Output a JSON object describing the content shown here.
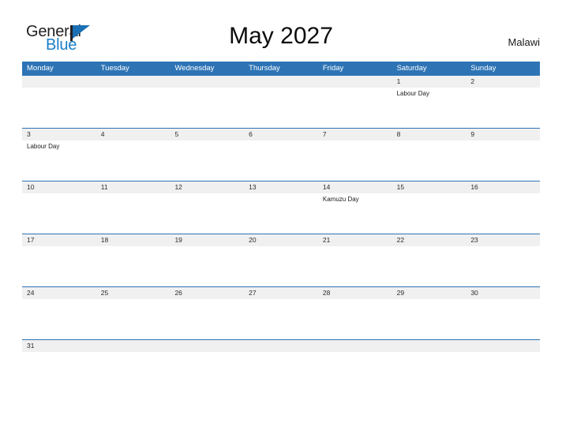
{
  "logo": {
    "text_dark": "General",
    "text_blue": "Blue",
    "accent_color": "#1a7ec8",
    "triangle_color": "#1a6fb5"
  },
  "header": {
    "title": "May 2027",
    "country": "Malawi"
  },
  "theme": {
    "header_blue": "#2e74b5",
    "row_band_gray": "#f0f0f0",
    "text_dark": "#1a1a1a"
  },
  "calendar": {
    "month": "May",
    "year": "2027",
    "weekday_headers": [
      "Monday",
      "Tuesday",
      "Wednesday",
      "Thursday",
      "Friday",
      "Saturday",
      "Sunday"
    ],
    "weeks": [
      {
        "days": [
          {
            "num": "",
            "event": ""
          },
          {
            "num": "",
            "event": ""
          },
          {
            "num": "",
            "event": ""
          },
          {
            "num": "",
            "event": ""
          },
          {
            "num": "",
            "event": ""
          },
          {
            "num": "1",
            "event": "Labour Day"
          },
          {
            "num": "2",
            "event": ""
          }
        ]
      },
      {
        "days": [
          {
            "num": "3",
            "event": "Labour Day"
          },
          {
            "num": "4",
            "event": ""
          },
          {
            "num": "5",
            "event": ""
          },
          {
            "num": "6",
            "event": ""
          },
          {
            "num": "7",
            "event": ""
          },
          {
            "num": "8",
            "event": ""
          },
          {
            "num": "9",
            "event": ""
          }
        ]
      },
      {
        "days": [
          {
            "num": "10",
            "event": ""
          },
          {
            "num": "11",
            "event": ""
          },
          {
            "num": "12",
            "event": ""
          },
          {
            "num": "13",
            "event": ""
          },
          {
            "num": "14",
            "event": "Kamuzu Day"
          },
          {
            "num": "15",
            "event": ""
          },
          {
            "num": "16",
            "event": ""
          }
        ]
      },
      {
        "days": [
          {
            "num": "17",
            "event": ""
          },
          {
            "num": "18",
            "event": ""
          },
          {
            "num": "19",
            "event": ""
          },
          {
            "num": "20",
            "event": ""
          },
          {
            "num": "21",
            "event": ""
          },
          {
            "num": "22",
            "event": ""
          },
          {
            "num": "23",
            "event": ""
          }
        ]
      },
      {
        "days": [
          {
            "num": "24",
            "event": ""
          },
          {
            "num": "25",
            "event": ""
          },
          {
            "num": "26",
            "event": ""
          },
          {
            "num": "27",
            "event": ""
          },
          {
            "num": "28",
            "event": ""
          },
          {
            "num": "29",
            "event": ""
          },
          {
            "num": "30",
            "event": ""
          }
        ]
      },
      {
        "days": [
          {
            "num": "31",
            "event": ""
          },
          {
            "num": "",
            "event": ""
          },
          {
            "num": "",
            "event": ""
          },
          {
            "num": "",
            "event": ""
          },
          {
            "num": "",
            "event": ""
          },
          {
            "num": "",
            "event": ""
          },
          {
            "num": "",
            "event": ""
          }
        ]
      }
    ]
  }
}
